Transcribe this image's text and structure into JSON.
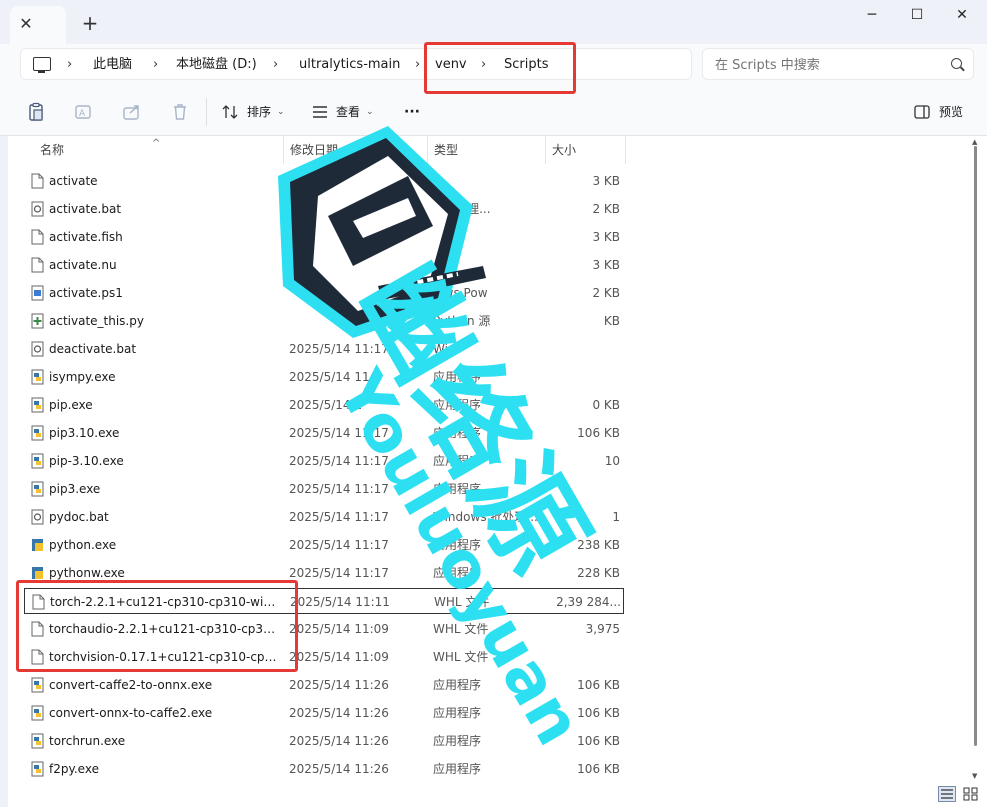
{
  "window": {
    "new_tab_label": "+",
    "close_tab_label": "✕",
    "minimize_label": "─",
    "maximize_label": "☐",
    "close_label": "✕"
  },
  "breadcrumb": {
    "items": [
      "此电脑",
      "本地磁盘 (D:)",
      "ultralytics-main",
      "venv",
      "Scripts"
    ],
    "separator": "›"
  },
  "search": {
    "placeholder": "在 Scripts 中搜索"
  },
  "toolbar": {
    "sort_label": "排序",
    "view_label": "查看",
    "more_label": "···",
    "preview_label": "预览"
  },
  "columns": {
    "name": "名称",
    "date": "修改日期",
    "type": "类型",
    "size": "大小"
  },
  "files": [
    {
      "name": "activate",
      "date": "",
      "type": "",
      "size": "3 KB",
      "icon": "file-icon"
    },
    {
      "name": "activate.bat",
      "date": "",
      "type": "s 批处理...",
      "size": "2 KB",
      "icon": "batch-file-icon"
    },
    {
      "name": "activate.fish",
      "date": "",
      "type": "",
      "size": "3 KB",
      "icon": "file-icon"
    },
    {
      "name": "activate.nu",
      "date": "",
      "type": "",
      "size": "3 KB",
      "icon": "file-icon"
    },
    {
      "name": "activate.ps1",
      "date": "",
      "type": "lows Pow",
      "size": "2 KB",
      "icon": "powershell-file-icon"
    },
    {
      "name": "activate_this.py",
      "date": "",
      "type": "Python 源",
      "size": "KB",
      "icon": "python-file-icon"
    },
    {
      "name": "deactivate.bat",
      "date": "2025/5/14 11:17",
      "type": "Win",
      "size": "",
      "icon": "batch-file-icon"
    },
    {
      "name": "isympy.exe",
      "date": "2025/5/14 11:2",
      "type": "应用程序",
      "size": "",
      "icon": "python-exe-icon"
    },
    {
      "name": "pip.exe",
      "date": "2025/5/14 1",
      "type": "应用程序",
      "size": "0 KB",
      "icon": "python-exe-icon"
    },
    {
      "name": "pip3.10.exe",
      "date": "2025/5/14 11:17",
      "type": "应用程序",
      "size": "106 KB",
      "icon": "python-exe-icon"
    },
    {
      "name": "pip-3.10.exe",
      "date": "2025/5/14 11:17",
      "type": "应用程序",
      "size": "10",
      "icon": "python-exe-icon"
    },
    {
      "name": "pip3.exe",
      "date": "2025/5/14 11:17",
      "type": "应用程序",
      "size": "",
      "icon": "python-exe-icon"
    },
    {
      "name": "pydoc.bat",
      "date": "2025/5/14 11:17",
      "type": "Windows 批处理...",
      "size": "1",
      "icon": "batch-file-icon"
    },
    {
      "name": "python.exe",
      "date": "2025/5/14 11:17",
      "type": "应用程序",
      "size": "238 KB",
      "icon": "python-app-icon"
    },
    {
      "name": "pythonw.exe",
      "date": "2025/5/14 11:17",
      "type": "应用程序",
      "size": "228 KB",
      "icon": "python-app-icon"
    },
    {
      "name": "torch-2.2.1+cu121-cp310-cp310-win_...",
      "date": "2025/5/14 11:11",
      "type": "WHL 文件",
      "size": "2,39 284...",
      "icon": "file-icon",
      "selected": true
    },
    {
      "name": "torchaudio-2.2.1+cu121-cp310-cp31...",
      "date": "2025/5/14 11:09",
      "type": "WHL 文件",
      "size": "3,975",
      "icon": "file-icon"
    },
    {
      "name": "torchvision-0.17.1+cu121-cp310-cp3...",
      "date": "2025/5/14 11:09",
      "type": "WHL 文件",
      "size": "",
      "icon": "file-icon"
    },
    {
      "name": "convert-caffe2-to-onnx.exe",
      "date": "2025/5/14 11:26",
      "type": "应用程序",
      "size": "106 KB",
      "icon": "python-exe-icon"
    },
    {
      "name": "convert-onnx-to-caffe2.exe",
      "date": "2025/5/14 11:26",
      "type": "应用程序",
      "size": "106 KB",
      "icon": "python-exe-icon"
    },
    {
      "name": "torchrun.exe",
      "date": "2025/5/14 11:26",
      "type": "应用程序",
      "size": "106 KB",
      "icon": "python-exe-icon"
    },
    {
      "name": "f2py.exe",
      "date": "2025/5/14 11:26",
      "type": "应用程序",
      "size": "106 KB",
      "icon": "python-exe-icon"
    }
  ],
  "watermark": {
    "cn_text": "幽络源",
    "en_text": "Youluoyuan",
    "color": "#2ce0f2"
  },
  "colors": {
    "highlight": "#e53935",
    "accent": "#2ce0f2"
  }
}
